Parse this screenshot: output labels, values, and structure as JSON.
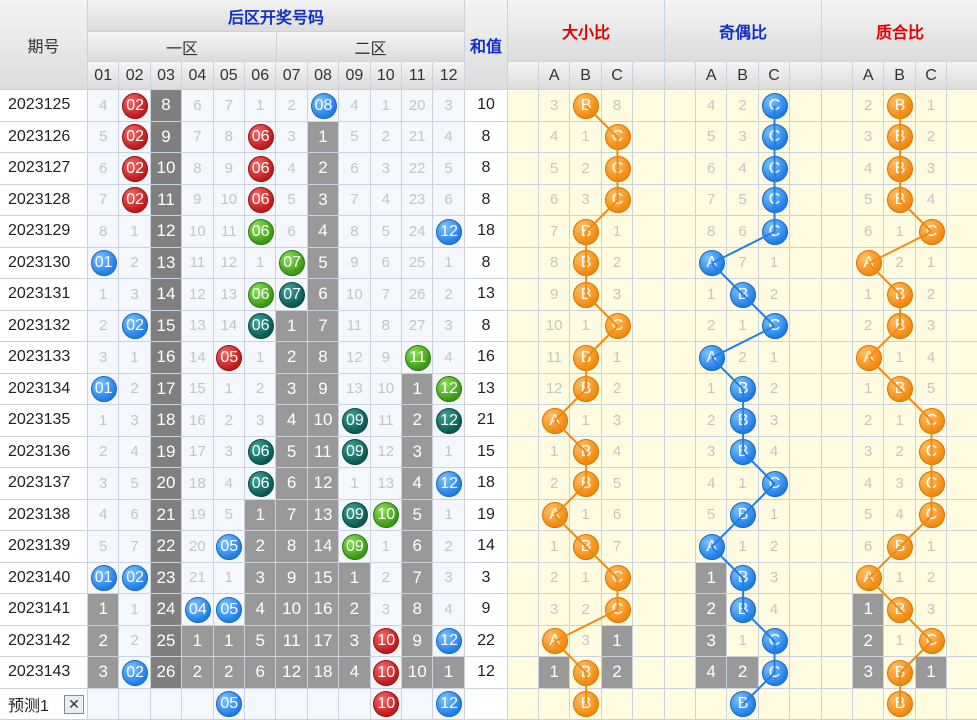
{
  "headers": {
    "period": "期号",
    "back_title": "后区开奖号码",
    "zone1": "一区",
    "zone2": "二区",
    "sum": "和值",
    "size_ratio": "大小比",
    "odd_even_ratio": "奇偶比",
    "prime_ratio": "质合比",
    "numbers": [
      "01",
      "02",
      "03",
      "04",
      "05",
      "06",
      "07",
      "08",
      "09",
      "10",
      "11",
      "12"
    ],
    "abc": [
      "A",
      "B",
      "C"
    ]
  },
  "colors": {
    "red": "#c01a1a",
    "blue": "#1f7fe8",
    "green": "#3a9a12",
    "teal": "#0c5a52",
    "orange": "#f28a10"
  },
  "rows": [
    {
      "period": "2023125",
      "nums": [
        "4",
        {
          "v": "02",
          "c": "red"
        },
        {
          "v": "8",
          "blk": 1
        },
        "6",
        "7",
        "1",
        "2",
        {
          "v": "08",
          "c": "blue"
        },
        "4",
        "1",
        "20",
        "3"
      ],
      "sum": "10",
      "size": [
        "3",
        {
          "v": "B",
          "c": "orange"
        },
        "8"
      ],
      "oe": [
        "4",
        "2",
        {
          "v": "C",
          "c": "blue"
        }
      ],
      "pr": [
        "2",
        {
          "v": "B",
          "c": "orange"
        },
        "1"
      ]
    },
    {
      "period": "2023126",
      "nums": [
        "5",
        {
          "v": "02",
          "c": "red"
        },
        {
          "v": "9",
          "blk": 1
        },
        "7",
        "8",
        {
          "v": "06",
          "c": "red"
        },
        "3",
        {
          "v": "1",
          "blk": 1
        },
        "5",
        "2",
        "21",
        "4"
      ],
      "sum": "8",
      "size": [
        "4",
        "1",
        {
          "v": "C",
          "c": "orange"
        }
      ],
      "oe": [
        "5",
        "3",
        {
          "v": "C",
          "c": "blue"
        }
      ],
      "pr": [
        "3",
        {
          "v": "B",
          "c": "orange"
        },
        "2"
      ]
    },
    {
      "period": "2023127",
      "nums": [
        "6",
        {
          "v": "02",
          "c": "red"
        },
        {
          "v": "10",
          "blk": 1
        },
        "8",
        "9",
        {
          "v": "06",
          "c": "red"
        },
        "4",
        {
          "v": "2",
          "blk": 1
        },
        "6",
        "3",
        "22",
        "5"
      ],
      "sum": "8",
      "size": [
        "5",
        "2",
        {
          "v": "C",
          "c": "orange"
        }
      ],
      "oe": [
        "6",
        "4",
        {
          "v": "C",
          "c": "blue"
        }
      ],
      "pr": [
        "4",
        {
          "v": "B",
          "c": "orange"
        },
        "3"
      ]
    },
    {
      "period": "2023128",
      "nums": [
        "7",
        {
          "v": "02",
          "c": "red"
        },
        {
          "v": "11",
          "blk": 1
        },
        "9",
        "10",
        {
          "v": "06",
          "c": "red"
        },
        "5",
        {
          "v": "3",
          "blk": 1
        },
        "7",
        "4",
        "23",
        "6"
      ],
      "sum": "8",
      "size": [
        "6",
        "3",
        {
          "v": "C",
          "c": "orange"
        }
      ],
      "oe": [
        "7",
        "5",
        {
          "v": "C",
          "c": "blue"
        }
      ],
      "pr": [
        "5",
        {
          "v": "B",
          "c": "orange"
        },
        "4"
      ]
    },
    {
      "period": "2023129",
      "nums": [
        "8",
        "1",
        {
          "v": "12",
          "blk": 1
        },
        "10",
        "11",
        {
          "v": "06",
          "c": "green"
        },
        "6",
        {
          "v": "4",
          "blk": 1
        },
        "8",
        "5",
        "24",
        {
          "v": "12",
          "c": "blue"
        }
      ],
      "sum": "18",
      "size": [
        "7",
        {
          "v": "B",
          "c": "orange"
        },
        "1"
      ],
      "oe": [
        "8",
        "6",
        {
          "v": "C",
          "c": "blue"
        }
      ],
      "pr": [
        "6",
        "1",
        {
          "v": "C",
          "c": "orange"
        }
      ]
    },
    {
      "period": "2023130",
      "nums": [
        {
          "v": "01",
          "c": "blue"
        },
        "2",
        {
          "v": "13",
          "blk": 1
        },
        "11",
        "12",
        "1",
        {
          "v": "07",
          "c": "green"
        },
        {
          "v": "5",
          "blk": 1
        },
        "9",
        "6",
        "25",
        "1"
      ],
      "sum": "8",
      "size": [
        "8",
        {
          "v": "B",
          "c": "orange"
        },
        "2"
      ],
      "oe": [
        {
          "v": "A",
          "c": "blue"
        },
        "7",
        "1"
      ],
      "pr": [
        {
          "v": "A",
          "c": "orange"
        },
        "2",
        "1"
      ]
    },
    {
      "period": "2023131",
      "nums": [
        "1",
        "3",
        {
          "v": "14",
          "blk": 1
        },
        "12",
        "13",
        {
          "v": "06",
          "c": "green"
        },
        {
          "v": "07",
          "c": "teal"
        },
        {
          "v": "6",
          "blk": 1
        },
        "10",
        "7",
        "26",
        "2"
      ],
      "sum": "13",
      "size": [
        "9",
        {
          "v": "B",
          "c": "orange"
        },
        "3"
      ],
      "oe": [
        "1",
        {
          "v": "B",
          "c": "blue"
        },
        "2"
      ],
      "pr": [
        "1",
        {
          "v": "B",
          "c": "orange"
        },
        "2"
      ]
    },
    {
      "period": "2023132",
      "nums": [
        "2",
        {
          "v": "02",
          "c": "blue"
        },
        {
          "v": "15",
          "blk": 1
        },
        "13",
        "14",
        {
          "v": "06",
          "c": "teal"
        },
        {
          "v": "1",
          "blk": 1
        },
        {
          "v": "7",
          "blk": 1
        },
        "11",
        "8",
        "27",
        "3"
      ],
      "sum": "8",
      "size": [
        "10",
        "1",
        {
          "v": "C",
          "c": "orange"
        }
      ],
      "oe": [
        "2",
        "1",
        {
          "v": "C",
          "c": "blue"
        }
      ],
      "pr": [
        "2",
        {
          "v": "B",
          "c": "orange"
        },
        "3"
      ]
    },
    {
      "period": "2023133",
      "nums": [
        "3",
        "1",
        {
          "v": "16",
          "blk": 1
        },
        "14",
        {
          "v": "05",
          "c": "red"
        },
        "1",
        {
          "v": "2",
          "blk": 1
        },
        {
          "v": "8",
          "blk": 1
        },
        "12",
        "9",
        {
          "v": "11",
          "c": "green"
        },
        "4"
      ],
      "sum": "16",
      "size": [
        "11",
        {
          "v": "B",
          "c": "orange"
        },
        "1"
      ],
      "oe": [
        {
          "v": "A",
          "c": "blue"
        },
        "2",
        "1"
      ],
      "pr": [
        {
          "v": "A",
          "c": "orange"
        },
        "1",
        "4"
      ]
    },
    {
      "period": "2023134",
      "nums": [
        {
          "v": "01",
          "c": "blue"
        },
        "2",
        {
          "v": "17",
          "blk": 1
        },
        "15",
        "1",
        "2",
        {
          "v": "3",
          "blk": 1
        },
        {
          "v": "9",
          "blk": 1
        },
        "13",
        "10",
        {
          "v": "1",
          "blk": 1
        },
        {
          "v": "12",
          "c": "green"
        }
      ],
      "sum": "13",
      "size": [
        "12",
        {
          "v": "B",
          "c": "orange"
        },
        "2"
      ],
      "oe": [
        "1",
        {
          "v": "B",
          "c": "blue"
        },
        "2"
      ],
      "pr": [
        "1",
        {
          "v": "B",
          "c": "orange"
        },
        "5"
      ]
    },
    {
      "period": "2023135",
      "nums": [
        "1",
        "3",
        {
          "v": "18",
          "blk": 1
        },
        "16",
        "2",
        "3",
        {
          "v": "4",
          "blk": 1
        },
        {
          "v": "10",
          "blk": 1
        },
        {
          "v": "09",
          "c": "teal"
        },
        "11",
        {
          "v": "2",
          "blk": 1
        },
        {
          "v": "12",
          "c": "teal"
        }
      ],
      "sum": "21",
      "size": [
        {
          "v": "A",
          "c": "orange"
        },
        "1",
        "3"
      ],
      "oe": [
        "2",
        {
          "v": "B",
          "c": "blue"
        },
        "3"
      ],
      "pr": [
        "2",
        "1",
        {
          "v": "C",
          "c": "orange"
        }
      ]
    },
    {
      "period": "2023136",
      "nums": [
        "2",
        "4",
        {
          "v": "19",
          "blk": 1
        },
        "17",
        "3",
        {
          "v": "06",
          "c": "teal"
        },
        {
          "v": "5",
          "blk": 1
        },
        {
          "v": "11",
          "blk": 1
        },
        {
          "v": "09",
          "c": "teal"
        },
        "12",
        {
          "v": "3",
          "blk": 1
        },
        "1"
      ],
      "sum": "15",
      "size": [
        "1",
        {
          "v": "B",
          "c": "orange"
        },
        "4"
      ],
      "oe": [
        "3",
        {
          "v": "B",
          "c": "blue"
        },
        "4"
      ],
      "pr": [
        "3",
        "2",
        {
          "v": "C",
          "c": "orange"
        }
      ]
    },
    {
      "period": "2023137",
      "nums": [
        "3",
        "5",
        {
          "v": "20",
          "blk": 1
        },
        "18",
        "4",
        {
          "v": "06",
          "c": "teal"
        },
        {
          "v": "6",
          "blk": 1
        },
        {
          "v": "12",
          "blk": 1
        },
        "1",
        "13",
        {
          "v": "4",
          "blk": 1
        },
        {
          "v": "12",
          "c": "blue"
        }
      ],
      "sum": "18",
      "size": [
        "2",
        {
          "v": "B",
          "c": "orange"
        },
        "5"
      ],
      "oe": [
        "4",
        "1",
        {
          "v": "C",
          "c": "blue"
        }
      ],
      "pr": [
        "4",
        "3",
        {
          "v": "C",
          "c": "orange"
        }
      ]
    },
    {
      "period": "2023138",
      "nums": [
        "4",
        "6",
        {
          "v": "21",
          "blk": 1
        },
        "19",
        "5",
        {
          "v": "1",
          "blk": 1
        },
        {
          "v": "7",
          "blk": 1
        },
        {
          "v": "13",
          "blk": 1
        },
        {
          "v": "09",
          "c": "teal"
        },
        {
          "v": "10",
          "c": "green"
        },
        {
          "v": "5",
          "blk": 1
        },
        "1"
      ],
      "sum": "19",
      "size": [
        {
          "v": "A",
          "c": "orange"
        },
        "1",
        "6"
      ],
      "oe": [
        "5",
        {
          "v": "B",
          "c": "blue"
        },
        "1"
      ],
      "pr": [
        "5",
        "4",
        {
          "v": "C",
          "c": "orange"
        }
      ]
    },
    {
      "period": "2023139",
      "nums": [
        "5",
        "7",
        {
          "v": "22",
          "blk": 1
        },
        "20",
        {
          "v": "05",
          "c": "blue"
        },
        {
          "v": "2",
          "blk": 1
        },
        {
          "v": "8",
          "blk": 1
        },
        {
          "v": "14",
          "blk": 1
        },
        {
          "v": "09",
          "c": "green"
        },
        "1",
        {
          "v": "6",
          "blk": 1
        },
        "2"
      ],
      "sum": "14",
      "size": [
        "1",
        {
          "v": "B",
          "c": "orange"
        },
        "7"
      ],
      "oe": [
        {
          "v": "A",
          "c": "blue"
        },
        "1",
        "2"
      ],
      "pr": [
        "6",
        {
          "v": "B",
          "c": "orange"
        },
        "1"
      ]
    },
    {
      "period": "2023140",
      "nums": [
        {
          "v": "01",
          "c": "blue"
        },
        {
          "v": "02",
          "c": "blue"
        },
        {
          "v": "23",
          "blk": 1
        },
        "21",
        "1",
        {
          "v": "3",
          "blk": 1
        },
        {
          "v": "9",
          "blk": 1
        },
        {
          "v": "15",
          "blk": 1
        },
        {
          "v": "1",
          "blk": 1
        },
        "2",
        {
          "v": "7",
          "blk": 1
        },
        "3"
      ],
      "sum": "3",
      "size": [
        "2",
        "1",
        {
          "v": "C",
          "c": "orange"
        }
      ],
      "oe": [
        {
          "v": "1",
          "blk": 1
        },
        {
          "v": "B",
          "c": "blue"
        },
        "3"
      ],
      "pr": [
        {
          "v": "A",
          "c": "orange"
        },
        "1",
        "2"
      ]
    },
    {
      "period": "2023141",
      "nums": [
        {
          "v": "1",
          "blk": 1
        },
        "1",
        {
          "v": "24",
          "blk": 1
        },
        {
          "v": "04",
          "c": "blue"
        },
        {
          "v": "05",
          "c": "blue"
        },
        {
          "v": "4",
          "blk": 1
        },
        {
          "v": "10",
          "blk": 1
        },
        {
          "v": "16",
          "blk": 1
        },
        {
          "v": "2",
          "blk": 1
        },
        "3",
        {
          "v": "8",
          "blk": 1
        },
        "4"
      ],
      "sum": "9",
      "size": [
        "3",
        "2",
        {
          "v": "C",
          "c": "orange"
        }
      ],
      "oe": [
        {
          "v": "2",
          "blk": 1
        },
        {
          "v": "B",
          "c": "blue"
        },
        "4"
      ],
      "pr": [
        {
          "v": "1",
          "blk": 1
        },
        {
          "v": "B",
          "c": "orange"
        },
        "3"
      ]
    },
    {
      "period": "2023142",
      "nums": [
        {
          "v": "2",
          "blk": 1
        },
        "2",
        {
          "v": "25",
          "blk": 1
        },
        {
          "v": "1",
          "blk": 1
        },
        {
          "v": "1",
          "blk": 1
        },
        {
          "v": "5",
          "blk": 1
        },
        {
          "v": "11",
          "blk": 1
        },
        {
          "v": "17",
          "blk": 1
        },
        {
          "v": "3",
          "blk": 1
        },
        {
          "v": "10",
          "c": "red"
        },
        {
          "v": "9",
          "blk": 1
        },
        {
          "v": "12",
          "c": "blue"
        }
      ],
      "sum": "22",
      "size": [
        {
          "v": "A",
          "c": "orange"
        },
        "3",
        {
          "v": "1",
          "blk": 1
        }
      ],
      "oe": [
        {
          "v": "3",
          "blk": 1
        },
        "1",
        {
          "v": "C",
          "c": "blue"
        }
      ],
      "pr": [
        {
          "v": "2",
          "blk": 1
        },
        "1",
        {
          "v": "C",
          "c": "orange"
        }
      ]
    },
    {
      "period": "2023143",
      "nums": [
        {
          "v": "3",
          "blk": 1
        },
        {
          "v": "02",
          "c": "blue"
        },
        {
          "v": "26",
          "blk": 1
        },
        {
          "v": "2",
          "blk": 1
        },
        {
          "v": "2",
          "blk": 1
        },
        {
          "v": "6",
          "blk": 1
        },
        {
          "v": "12",
          "blk": 1
        },
        {
          "v": "18",
          "blk": 1
        },
        {
          "v": "4",
          "blk": 1
        },
        {
          "v": "10",
          "c": "red"
        },
        {
          "v": "10",
          "blk": 1
        },
        {
          "v": "1",
          "blk": 1
        }
      ],
      "sum": "12",
      "size": [
        {
          "v": "1",
          "blk": 1
        },
        {
          "v": "B",
          "c": "orange"
        },
        {
          "v": "2",
          "blk": 1
        }
      ],
      "oe": [
        {
          "v": "4",
          "blk": 1
        },
        {
          "v": "2",
          "blk": 1
        },
        {
          "v": "C",
          "c": "blue"
        }
      ],
      "pr": [
        {
          "v": "3",
          "blk": 1
        },
        {
          "v": "B",
          "c": "orange"
        },
        {
          "v": "1",
          "blk": 1
        }
      ]
    }
  ],
  "forecast": {
    "label": "预测1",
    "close": "✕",
    "nums": [
      "",
      "",
      "",
      "",
      {
        "v": "05",
        "c": "blue"
      },
      "",
      "",
      "",
      "",
      {
        "v": "10",
        "c": "red"
      },
      "",
      {
        "v": "12",
        "c": "blue"
      }
    ],
    "size": [
      "",
      {
        "v": "B",
        "c": "orange"
      },
      ""
    ],
    "oe": [
      "",
      {
        "v": "B",
        "c": "blue"
      },
      ""
    ],
    "pr": [
      "",
      {
        "v": "B",
        "c": "orange"
      },
      ""
    ]
  }
}
